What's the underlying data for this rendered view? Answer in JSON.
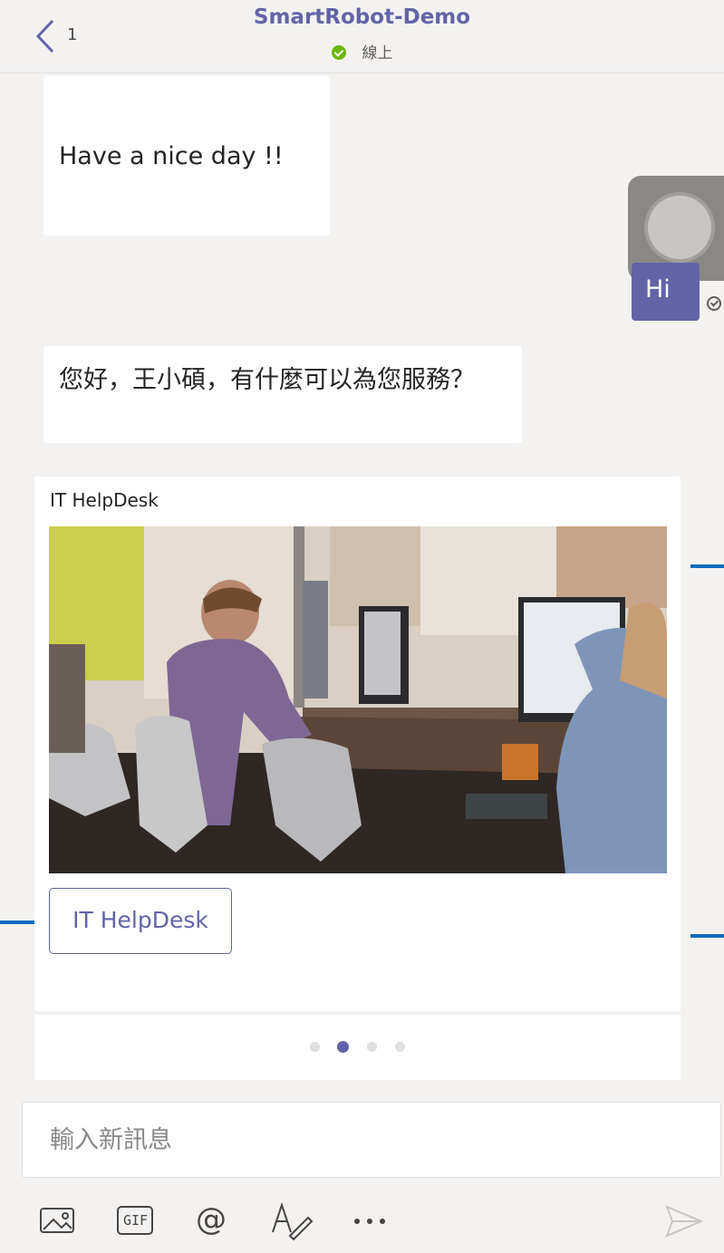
{
  "header": {
    "back_count": "1",
    "title": "SmartRobot-Demo",
    "status": "線上"
  },
  "messages": {
    "bot_1": "Have a nice day !!",
    "user_hi": "Hi",
    "bot_2": "您好，王小碩，有什麼可以為您服務？"
  },
  "card": {
    "title": "IT HelpDesk",
    "button_label": "IT HelpDesk",
    "pager": {
      "count": 4,
      "active_index": 1
    }
  },
  "compose": {
    "placeholder": "輸入新訊息"
  },
  "toolbar": {
    "items": [
      "image-icon",
      "gif-icon",
      "mention-icon",
      "format-icon",
      "more-icon",
      "send-icon"
    ],
    "gif_label": "GIF",
    "mention_label": "@"
  },
  "colors": {
    "accent": "#6264a7",
    "online": "#6bb700",
    "background": "#f3f2f1"
  }
}
